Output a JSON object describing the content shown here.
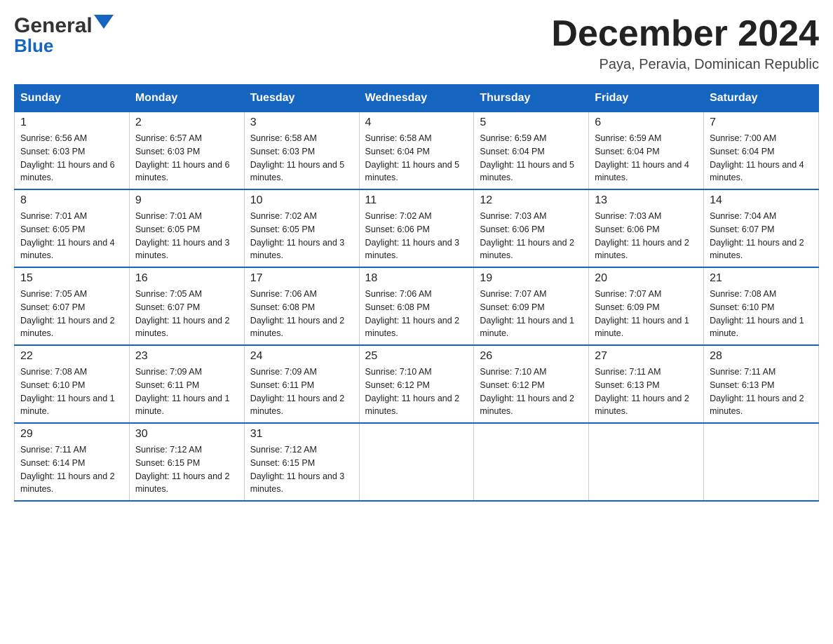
{
  "logo": {
    "line1": "General",
    "triangle": "▲",
    "line2": "Blue"
  },
  "title": "December 2024",
  "subtitle": "Paya, Peravia, Dominican Republic",
  "days": [
    "Sunday",
    "Monday",
    "Tuesday",
    "Wednesday",
    "Thursday",
    "Friday",
    "Saturday"
  ],
  "weeks": [
    [
      {
        "num": "1",
        "sunrise": "6:56 AM",
        "sunset": "6:03 PM",
        "daylight": "11 hours and 6 minutes."
      },
      {
        "num": "2",
        "sunrise": "6:57 AM",
        "sunset": "6:03 PM",
        "daylight": "11 hours and 6 minutes."
      },
      {
        "num": "3",
        "sunrise": "6:58 AM",
        "sunset": "6:03 PM",
        "daylight": "11 hours and 5 minutes."
      },
      {
        "num": "4",
        "sunrise": "6:58 AM",
        "sunset": "6:04 PM",
        "daylight": "11 hours and 5 minutes."
      },
      {
        "num": "5",
        "sunrise": "6:59 AM",
        "sunset": "6:04 PM",
        "daylight": "11 hours and 5 minutes."
      },
      {
        "num": "6",
        "sunrise": "6:59 AM",
        "sunset": "6:04 PM",
        "daylight": "11 hours and 4 minutes."
      },
      {
        "num": "7",
        "sunrise": "7:00 AM",
        "sunset": "6:04 PM",
        "daylight": "11 hours and 4 minutes."
      }
    ],
    [
      {
        "num": "8",
        "sunrise": "7:01 AM",
        "sunset": "6:05 PM",
        "daylight": "11 hours and 4 minutes."
      },
      {
        "num": "9",
        "sunrise": "7:01 AM",
        "sunset": "6:05 PM",
        "daylight": "11 hours and 3 minutes."
      },
      {
        "num": "10",
        "sunrise": "7:02 AM",
        "sunset": "6:05 PM",
        "daylight": "11 hours and 3 minutes."
      },
      {
        "num": "11",
        "sunrise": "7:02 AM",
        "sunset": "6:06 PM",
        "daylight": "11 hours and 3 minutes."
      },
      {
        "num": "12",
        "sunrise": "7:03 AM",
        "sunset": "6:06 PM",
        "daylight": "11 hours and 2 minutes."
      },
      {
        "num": "13",
        "sunrise": "7:03 AM",
        "sunset": "6:06 PM",
        "daylight": "11 hours and 2 minutes."
      },
      {
        "num": "14",
        "sunrise": "7:04 AM",
        "sunset": "6:07 PM",
        "daylight": "11 hours and 2 minutes."
      }
    ],
    [
      {
        "num": "15",
        "sunrise": "7:05 AM",
        "sunset": "6:07 PM",
        "daylight": "11 hours and 2 minutes."
      },
      {
        "num": "16",
        "sunrise": "7:05 AM",
        "sunset": "6:07 PM",
        "daylight": "11 hours and 2 minutes."
      },
      {
        "num": "17",
        "sunrise": "7:06 AM",
        "sunset": "6:08 PM",
        "daylight": "11 hours and 2 minutes."
      },
      {
        "num": "18",
        "sunrise": "7:06 AM",
        "sunset": "6:08 PM",
        "daylight": "11 hours and 2 minutes."
      },
      {
        "num": "19",
        "sunrise": "7:07 AM",
        "sunset": "6:09 PM",
        "daylight": "11 hours and 1 minute."
      },
      {
        "num": "20",
        "sunrise": "7:07 AM",
        "sunset": "6:09 PM",
        "daylight": "11 hours and 1 minute."
      },
      {
        "num": "21",
        "sunrise": "7:08 AM",
        "sunset": "6:10 PM",
        "daylight": "11 hours and 1 minute."
      }
    ],
    [
      {
        "num": "22",
        "sunrise": "7:08 AM",
        "sunset": "6:10 PM",
        "daylight": "11 hours and 1 minute."
      },
      {
        "num": "23",
        "sunrise": "7:09 AM",
        "sunset": "6:11 PM",
        "daylight": "11 hours and 1 minute."
      },
      {
        "num": "24",
        "sunrise": "7:09 AM",
        "sunset": "6:11 PM",
        "daylight": "11 hours and 2 minutes."
      },
      {
        "num": "25",
        "sunrise": "7:10 AM",
        "sunset": "6:12 PM",
        "daylight": "11 hours and 2 minutes."
      },
      {
        "num": "26",
        "sunrise": "7:10 AM",
        "sunset": "6:12 PM",
        "daylight": "11 hours and 2 minutes."
      },
      {
        "num": "27",
        "sunrise": "7:11 AM",
        "sunset": "6:13 PM",
        "daylight": "11 hours and 2 minutes."
      },
      {
        "num": "28",
        "sunrise": "7:11 AM",
        "sunset": "6:13 PM",
        "daylight": "11 hours and 2 minutes."
      }
    ],
    [
      {
        "num": "29",
        "sunrise": "7:11 AM",
        "sunset": "6:14 PM",
        "daylight": "11 hours and 2 minutes."
      },
      {
        "num": "30",
        "sunrise": "7:12 AM",
        "sunset": "6:15 PM",
        "daylight": "11 hours and 2 minutes."
      },
      {
        "num": "31",
        "sunrise": "7:12 AM",
        "sunset": "6:15 PM",
        "daylight": "11 hours and 3 minutes."
      },
      null,
      null,
      null,
      null
    ]
  ],
  "labels": {
    "sunrise": "Sunrise:",
    "sunset": "Sunset:",
    "daylight": "Daylight:"
  }
}
